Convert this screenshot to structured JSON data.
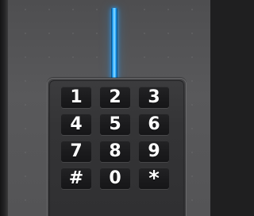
{
  "indicator": {
    "color": "#1aa0ff"
  },
  "keypad": {
    "keys": [
      {
        "label": "1"
      },
      {
        "label": "2"
      },
      {
        "label": "3"
      },
      {
        "label": "4"
      },
      {
        "label": "5"
      },
      {
        "label": "6"
      },
      {
        "label": "7"
      },
      {
        "label": "8"
      },
      {
        "label": "9"
      },
      {
        "label": "#"
      },
      {
        "label": "0"
      },
      {
        "label": "*"
      }
    ]
  }
}
